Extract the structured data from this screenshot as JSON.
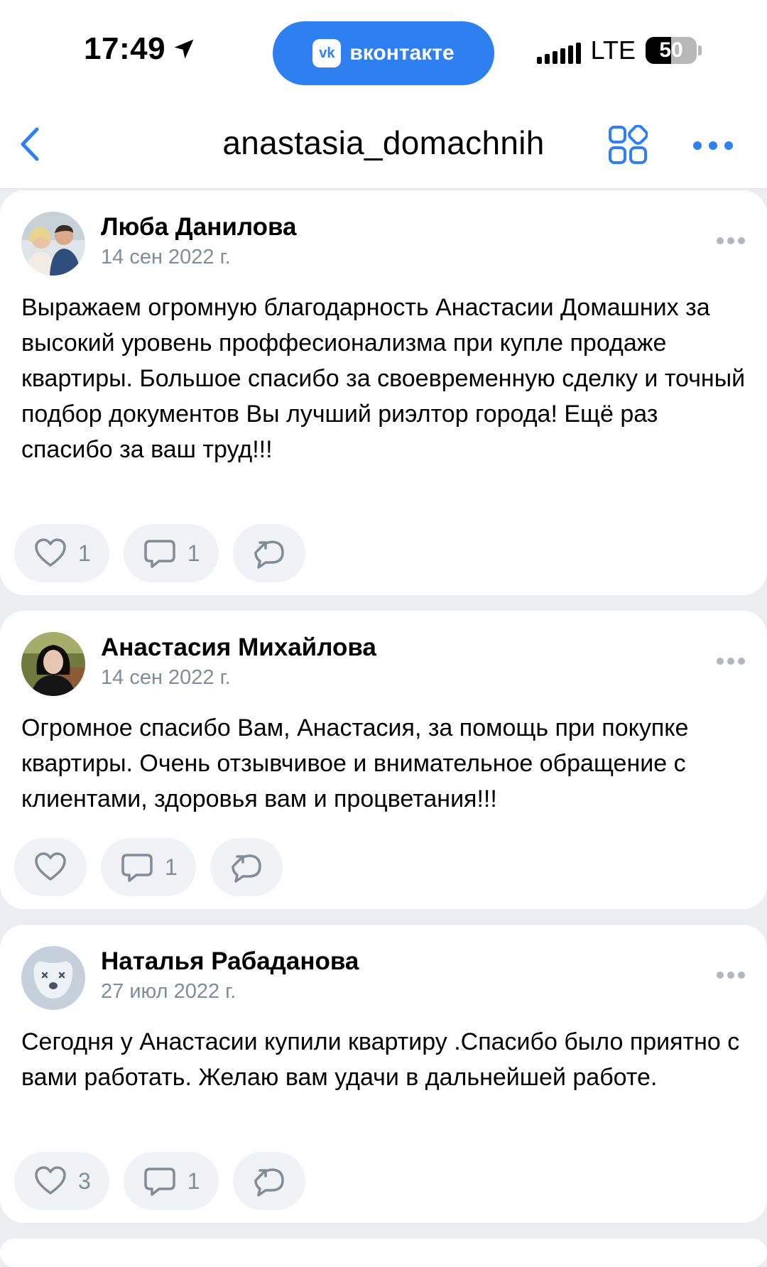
{
  "status_bar": {
    "time": "17:49",
    "app_pill_label": "вконтакте",
    "app_logo_text": "vk",
    "network": "LTE",
    "battery": "50",
    "battery_level": 0.5
  },
  "header": {
    "title": "anastasia_domachnih"
  },
  "posts": [
    {
      "author": "Люба Данилова",
      "date": "14 сен 2022 г.",
      "text": "Выражаем огромную благодарность Анастасии Домашних за высокий уровень проффесионализма при купле продаже квартиры. Большое спасибо за своевременную сделку и точный подбор документов Вы лучший риэлтор города! Ещё раз спасибо за ваш труд!!!",
      "likes": "1",
      "comments": "1"
    },
    {
      "author": "Анастасия Михайлова",
      "date": "14 сен 2022 г.",
      "text": "Огромное спасибо Вам, Анастасия, за помощь при покупке квартиры. Очень отзывчивое и внимательное обращение с клиентами, здоровья вам и процветания!!!",
      "likes": "",
      "comments": "1"
    },
    {
      "author": "Наталья Рабаданова",
      "date": "27 июл 2022 г.",
      "text": "Сегодня  у Анастасии  купили квартиру .Спасибо было приятно с вами работать. Желаю вам удачи в дальнейшей работе.",
      "likes": "3",
      "comments": "1"
    }
  ],
  "colors": {
    "accent": "#2e7ff0",
    "secondary_text": "#818c99",
    "background": "#ebedf0",
    "button_bg": "#f0f2f5"
  }
}
